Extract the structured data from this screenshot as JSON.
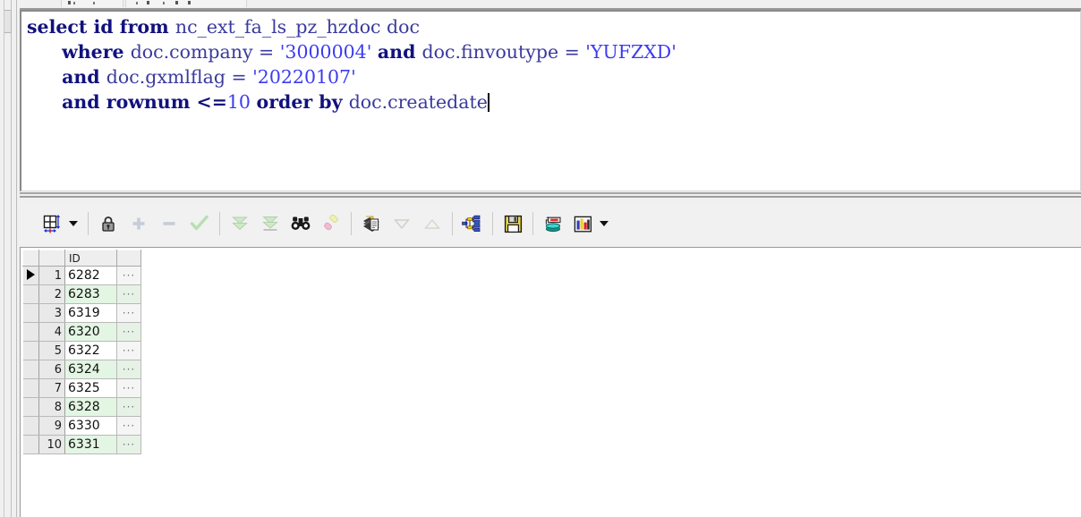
{
  "window": {
    "editor_caret_visible": true
  },
  "editor": {
    "name": "sql-editor",
    "lines": [
      [
        {
          "t": "select id from ",
          "c": "kw"
        },
        {
          "t": "nc_ext_fa_ls_pz_hzdoc doc",
          "c": "pl"
        }
      ],
      [
        {
          "t": "      ",
          "c": "pl"
        },
        {
          "t": "where ",
          "c": "kw"
        },
        {
          "t": "doc.company = ",
          "c": "pl"
        },
        {
          "t": "'3000004'",
          "c": "str"
        },
        {
          "t": " ",
          "c": "pl"
        },
        {
          "t": "and ",
          "c": "kw"
        },
        {
          "t": "doc.finvoutype = ",
          "c": "pl"
        },
        {
          "t": "'YUFZXD'",
          "c": "str"
        }
      ],
      [
        {
          "t": "      ",
          "c": "pl"
        },
        {
          "t": "and ",
          "c": "kw"
        },
        {
          "t": "doc.gxmlflag = ",
          "c": "pl"
        },
        {
          "t": "'20220107'",
          "c": "str"
        }
      ],
      [
        {
          "t": "      ",
          "c": "pl"
        },
        {
          "t": "and rownum ",
          "c": "kw"
        },
        {
          "t": "<=",
          "c": "op"
        },
        {
          "t": "10",
          "c": "num"
        },
        {
          "t": " ",
          "c": "pl"
        },
        {
          "t": "order by ",
          "c": "kw"
        },
        {
          "t": "doc.createdate",
          "c": "pl"
        }
      ]
    ],
    "plain_text": "select id from nc_ext_fa_ls_pz_hzdoc doc\n      where doc.company = '3000004' and doc.finvoutype = 'YUFZXD'\n      and doc.gxmlflag = '20220107'\n      and rownum <=10 order by doc.createdate"
  },
  "toolbar": {
    "name": "results-toolbar",
    "buttons": [
      {
        "id": "grid-layout",
        "icon": "grid-layout-icon",
        "label": "Grid layout",
        "enabled": true,
        "dropdown": true
      },
      {
        "id": "sep1",
        "icon": "separator",
        "label": "",
        "enabled": true,
        "dropdown": false
      },
      {
        "id": "lock-record",
        "icon": "lock-icon",
        "label": "Lock record",
        "enabled": true,
        "dropdown": false
      },
      {
        "id": "insert-record",
        "icon": "plus-icon",
        "label": "Insert record",
        "enabled": false,
        "dropdown": false
      },
      {
        "id": "delete-record",
        "icon": "minus-icon",
        "label": "Delete record",
        "enabled": false,
        "dropdown": false
      },
      {
        "id": "post-changes",
        "icon": "check-icon",
        "label": "Post changes",
        "enabled": false,
        "dropdown": false
      },
      {
        "id": "sep2",
        "icon": "separator",
        "label": "",
        "enabled": true,
        "dropdown": false
      },
      {
        "id": "fetch-next-page",
        "icon": "double-down-icon",
        "label": "Fetch next page",
        "enabled": false,
        "dropdown": false
      },
      {
        "id": "fetch-last-page",
        "icon": "down-to-bar-icon",
        "label": "Fetch last page",
        "enabled": false,
        "dropdown": false
      },
      {
        "id": "find-data",
        "icon": "binoculars-icon",
        "label": "Find data",
        "enabled": true,
        "dropdown": false
      },
      {
        "id": "clear-filter",
        "icon": "eraser-icon",
        "label": "Clear filter",
        "enabled": false,
        "dropdown": false
      },
      {
        "id": "sep3",
        "icon": "separator",
        "label": "",
        "enabled": true,
        "dropdown": false
      },
      {
        "id": "copy-to-clipboard",
        "icon": "copy-pages-icon",
        "label": "Copy to clipboard",
        "enabled": true,
        "dropdown": false
      },
      {
        "id": "sort-descending",
        "icon": "triangle-down-icon",
        "label": "Sort descending",
        "enabled": false,
        "dropdown": false
      },
      {
        "id": "sort-ascending",
        "icon": "triangle-up-icon",
        "label": "Sort ascending",
        "enabled": false,
        "dropdown": false
      },
      {
        "id": "sep4",
        "icon": "separator",
        "label": "",
        "enabled": true,
        "dropdown": false
      },
      {
        "id": "explain-plan",
        "icon": "plan-tree-icon",
        "label": "Explain plan",
        "enabled": true,
        "dropdown": false
      },
      {
        "id": "sep5",
        "icon": "separator",
        "label": "",
        "enabled": true,
        "dropdown": false
      },
      {
        "id": "export-save",
        "icon": "floppy-disk-icon",
        "label": "Export / Save",
        "enabled": true,
        "dropdown": false
      },
      {
        "id": "sep6",
        "icon": "separator",
        "label": "",
        "enabled": true,
        "dropdown": false
      },
      {
        "id": "single-record",
        "icon": "database-edit-icon",
        "label": "Single record view",
        "enabled": true,
        "dropdown": false
      },
      {
        "id": "chart-view",
        "icon": "bar-chart-icon",
        "label": "Chart",
        "enabled": true,
        "dropdown": true
      }
    ]
  },
  "results": {
    "name": "results-grid",
    "columns": [
      "",
      "",
      "ID",
      ""
    ],
    "id_header": "ID",
    "expand_glyph": "···",
    "selected_row": 1,
    "row_count": 10,
    "rows": [
      {
        "n": "1",
        "id": "6282"
      },
      {
        "n": "2",
        "id": "6283"
      },
      {
        "n": "3",
        "id": "6319"
      },
      {
        "n": "4",
        "id": "6320"
      },
      {
        "n": "5",
        "id": "6322"
      },
      {
        "n": "6",
        "id": "6324"
      },
      {
        "n": "7",
        "id": "6325"
      },
      {
        "n": "8",
        "id": "6328"
      },
      {
        "n": "9",
        "id": "6330"
      },
      {
        "n": "10",
        "id": "6331"
      }
    ]
  },
  "colors": {
    "keyword": "#11117e",
    "plain": "#3a3a9e",
    "string": "#3b3bf2",
    "grid_alt_row": "#e3f5e3",
    "toolbar_bg": "#f1f1f1",
    "window_bg": "#f0f0f0"
  }
}
